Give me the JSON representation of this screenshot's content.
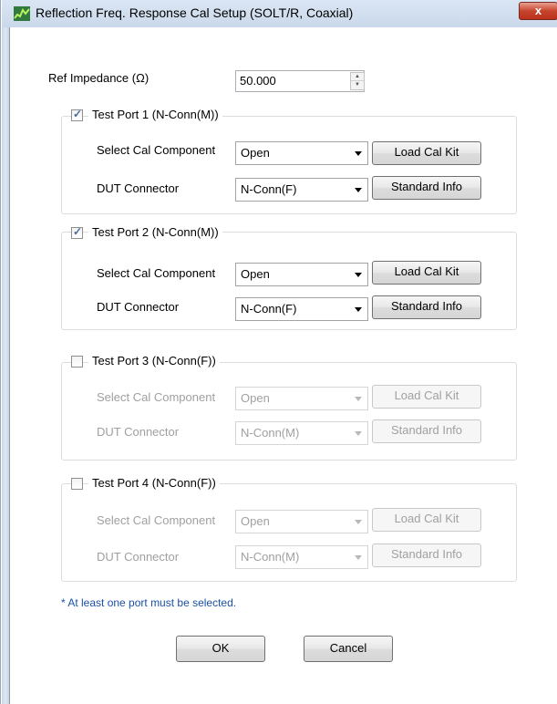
{
  "window": {
    "title": "Reflection Freq. Response Cal Setup (SOLT/R, Coaxial)",
    "close_glyph": "x",
    "icon": "spectrum-app-icon"
  },
  "ref_impedance": {
    "label": "Ref Impedance (Ω)",
    "value": "50.000"
  },
  "ports": [
    {
      "title": "Test Port 1 (N-Conn(M))",
      "checked": true,
      "select_cal_label": "Select Cal Component",
      "cal_component": "Open",
      "dut_label": "DUT Connector",
      "dut_connector": "N-Conn(F)",
      "load_cal_kit": "Load Cal Kit",
      "standard_info": "Standard Info"
    },
    {
      "title": "Test Port 2 (N-Conn(M))",
      "checked": true,
      "select_cal_label": "Select Cal Component",
      "cal_component": "Open",
      "dut_label": "DUT Connector",
      "dut_connector": "N-Conn(F)",
      "load_cal_kit": "Load Cal Kit",
      "standard_info": "Standard Info"
    },
    {
      "title": "Test Port 3 (N-Conn(F))",
      "checked": false,
      "select_cal_label": "Select Cal Component",
      "cal_component": "Open",
      "dut_label": "DUT Connector",
      "dut_connector": "N-Conn(M)",
      "load_cal_kit": "Load Cal Kit",
      "standard_info": "Standard Info"
    },
    {
      "title": "Test Port 4 (N-Conn(F))",
      "checked": false,
      "select_cal_label": "Select Cal Component",
      "cal_component": "Open",
      "dut_label": "DUT Connector",
      "dut_connector": "N-Conn(M)",
      "load_cal_kit": "Load Cal Kit",
      "standard_info": "Standard Info"
    }
  ],
  "note": "* At least one port must be selected.",
  "buttons": {
    "ok": "OK",
    "cancel": "Cancel"
  },
  "colors": {
    "note_text": "#1a50a8",
    "disabled_text": "#a0a0a0",
    "close_button": "#c7442c"
  }
}
